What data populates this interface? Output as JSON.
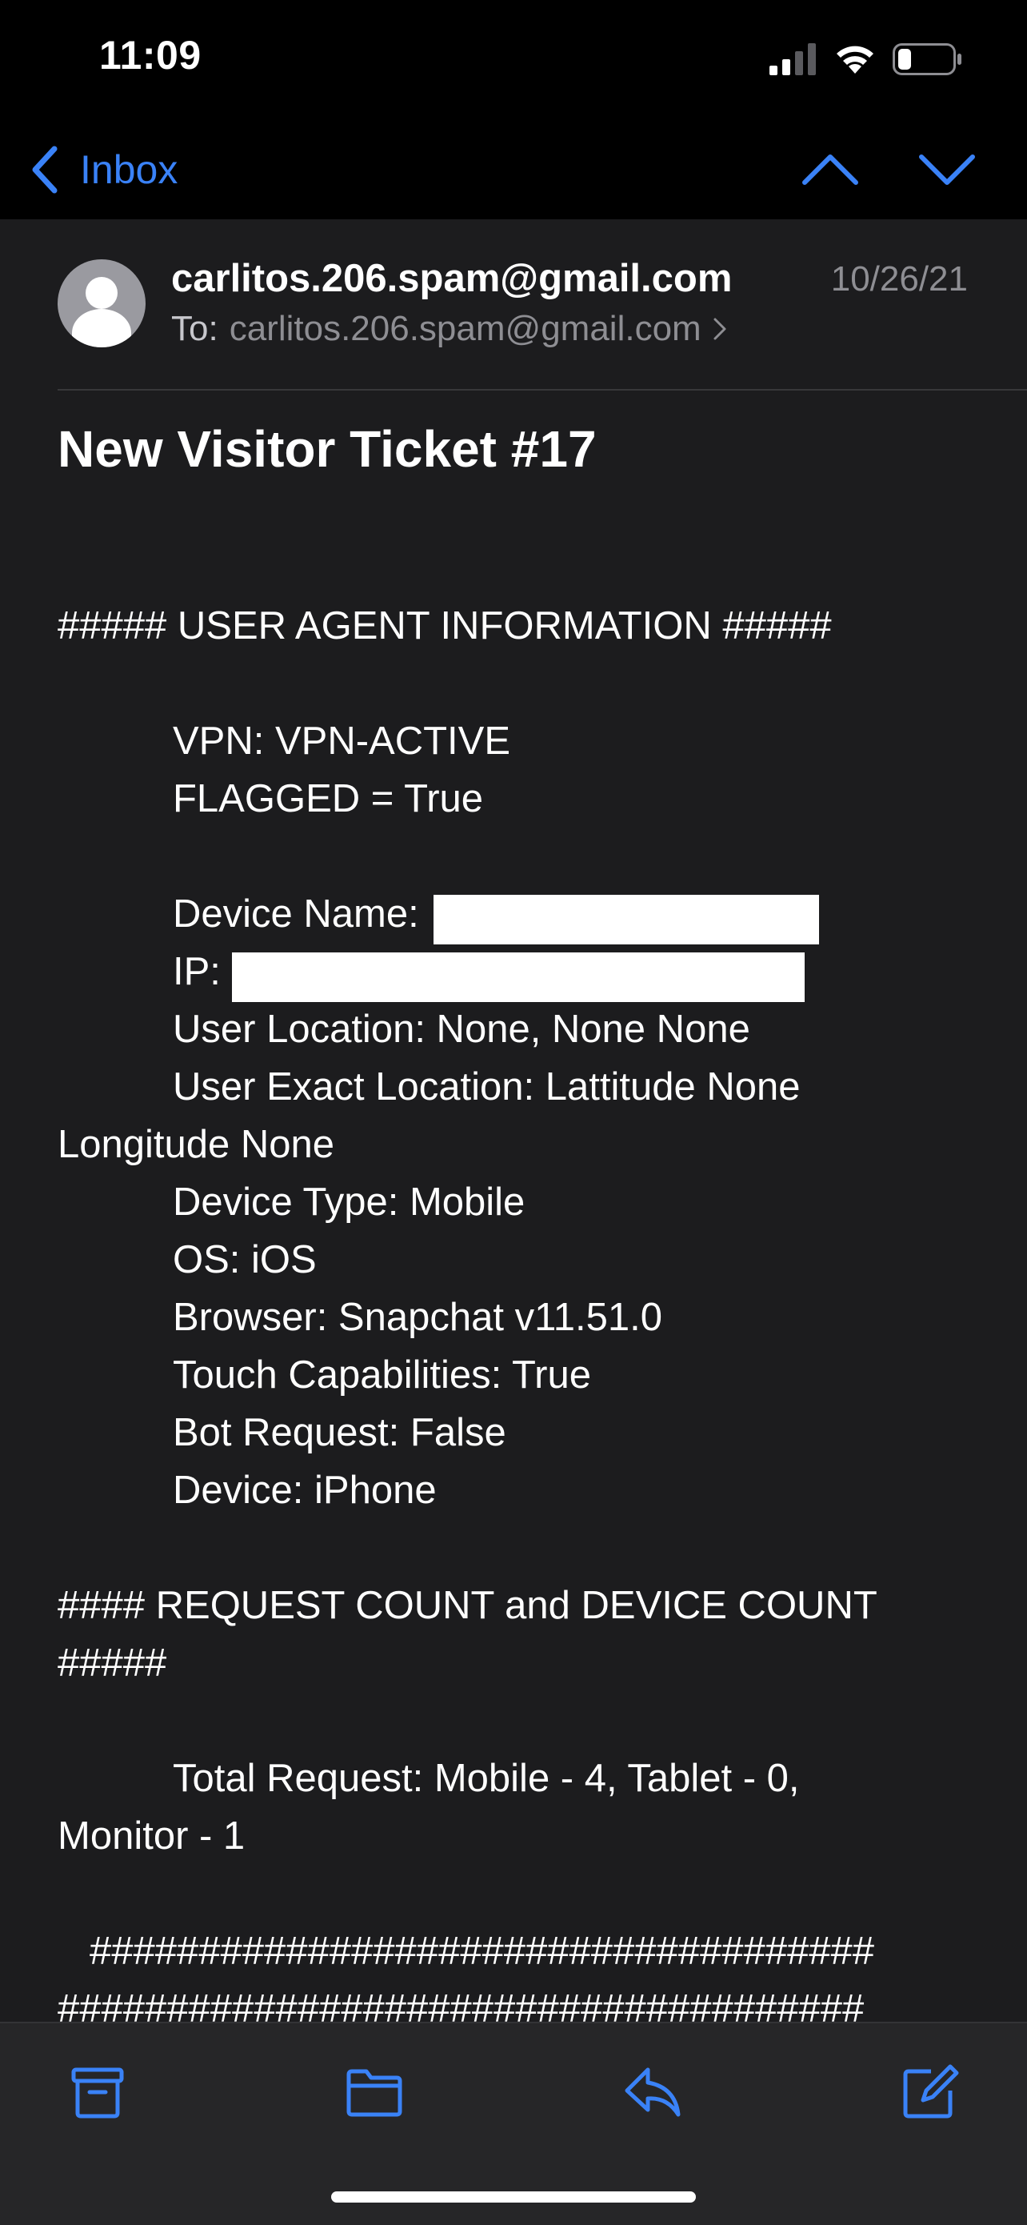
{
  "status_bar": {
    "time": "11:09"
  },
  "nav": {
    "back_label": "Inbox",
    "accent_color": "#3a82f7"
  },
  "email": {
    "sender": "carlitos.206.spam@gmail.com",
    "date": "10/26/21",
    "to_label": "To:",
    "to_address": "carlitos.206.spam@gmail.com",
    "subject": "New Visitor Ticket #17",
    "body": {
      "section1_heading": "##### USER AGENT INFORMATION #####",
      "vpn": "VPN: VPN-ACTIVE",
      "flagged": "FLAGGED = True",
      "device_name_label": "Device Name:",
      "ip_label": "IP:",
      "user_location": "User Location: None, None None",
      "exact_location_line1": "User Exact Location: Lattitude None",
      "exact_location_line2": "Longitude None",
      "device_type": "Device Type: Mobile",
      "os": "OS: iOS",
      "browser": "Browser: Snapchat v11.51.0",
      "touch": "Touch Capabilities: True",
      "bot": "Bot Request: False",
      "device": "Device: iPhone",
      "section2_heading_line1": "#### REQUEST COUNT and DEVICE COUNT",
      "section2_heading_line2": "#####",
      "total_request_line1": "Total Request: Mobile - 4, Tablet - 0,",
      "total_request_line2": "Monitor - 1",
      "hash_line1": "####################################",
      "hash_line2": "#####################################"
    }
  },
  "toolbar": {
    "icons": [
      "archive-icon",
      "folder-icon",
      "reply-icon",
      "compose-icon"
    ]
  }
}
